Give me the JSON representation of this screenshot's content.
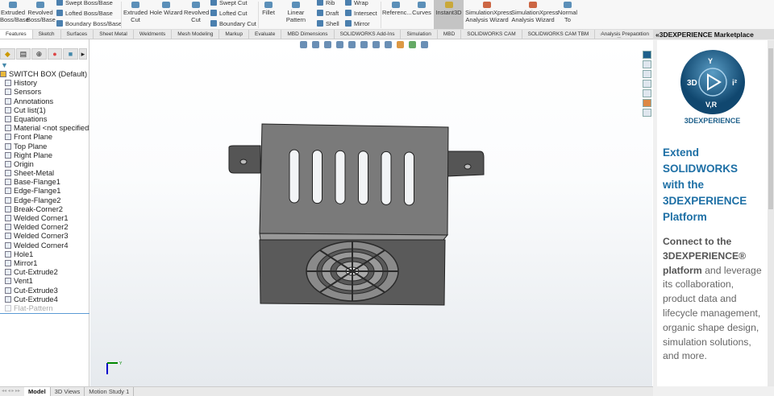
{
  "toolbar": {
    "extruded_boss": "Extruded Boss/Base",
    "revolved_boss": "Revolved Boss/Base",
    "swept_boss": "Swept Boss/Base",
    "lofted_boss": "Lofted Boss/Base",
    "boundary_boss": "Boundary Boss/Base",
    "extruded_cut": "Extruded Cut",
    "hole_wizard": "Hole Wizard",
    "revolved_cut": "Revolved Cut",
    "swept_cut": "Swept Cut",
    "lofted_cut": "Lofted Cut",
    "boundary_cut": "Boundary Cut",
    "fillet": "Fillet",
    "linear_pattern": "Linear Pattern",
    "rib": "Rib",
    "draft": "Draft",
    "shell": "Shell",
    "wrap": "Wrap",
    "intersect": "Intersect",
    "mirror": "Mirror",
    "reference": "Referenc...",
    "curves": "Curves",
    "instant3d": "Instant3D",
    "simx1": "SimulationXpress Analysis Wizard",
    "simx2": "SimulationXpress Analysis Wizard",
    "normal_to": "Normal To"
  },
  "tabs": [
    "Features",
    "Sketch",
    "Surfaces",
    "Sheet Metal",
    "Weldments",
    "Mesh Modeling",
    "Markup",
    "Evaluate",
    "MBD Dimensions",
    "SOLIDWORKS Add-Ins",
    "Simulation",
    "MBD",
    "SOLIDWORKS CAM",
    "SOLIDWORKS CAM TBM",
    "Analysis Preparation"
  ],
  "tree": {
    "root": "SWITCH BOX (Default) <<Default>",
    "items": [
      "History",
      "Sensors",
      "Annotations",
      "Cut list(1)",
      "Equations",
      "Material <not specified>",
      "Front Plane",
      "Top Plane",
      "Right Plane",
      "Origin",
      "Sheet-Metal",
      "Base-Flange1",
      "Edge-Flange1",
      "Edge-Flange2",
      "Break-Corner2",
      "Welded Corner1",
      "Welded Corner2",
      "Welded Corner3",
      "Welded Corner4",
      "Hole1",
      "Mirror1",
      "Cut-Extrude2",
      "Vent1",
      "Cut-Extrude3",
      "Cut-Extrude4"
    ],
    "suppressed": "Flat-Pattern"
  },
  "task_pane": {
    "title": "«3DEXPERIENCE Marketplace",
    "logo_text": "3DEXPERIENCE",
    "logo_labels": [
      "3D",
      "V+R",
      "i²"
    ],
    "headline": [
      "Extend",
      "SOLIDWORKS",
      "with the",
      "3DEXPERIENCE",
      "Platform"
    ],
    "para_bold": "Connect to the 3DEXPERIENCE® platform",
    "para": " and leverage its collaboration, product data and lifecycle management, organic shape design, simulation solutions, and more."
  },
  "bottom_tabs": [
    "Model",
    "3D Views",
    "Motion Study 1"
  ],
  "colors": {
    "accent": "#1d6fa5",
    "model": "#5f5f5f"
  }
}
